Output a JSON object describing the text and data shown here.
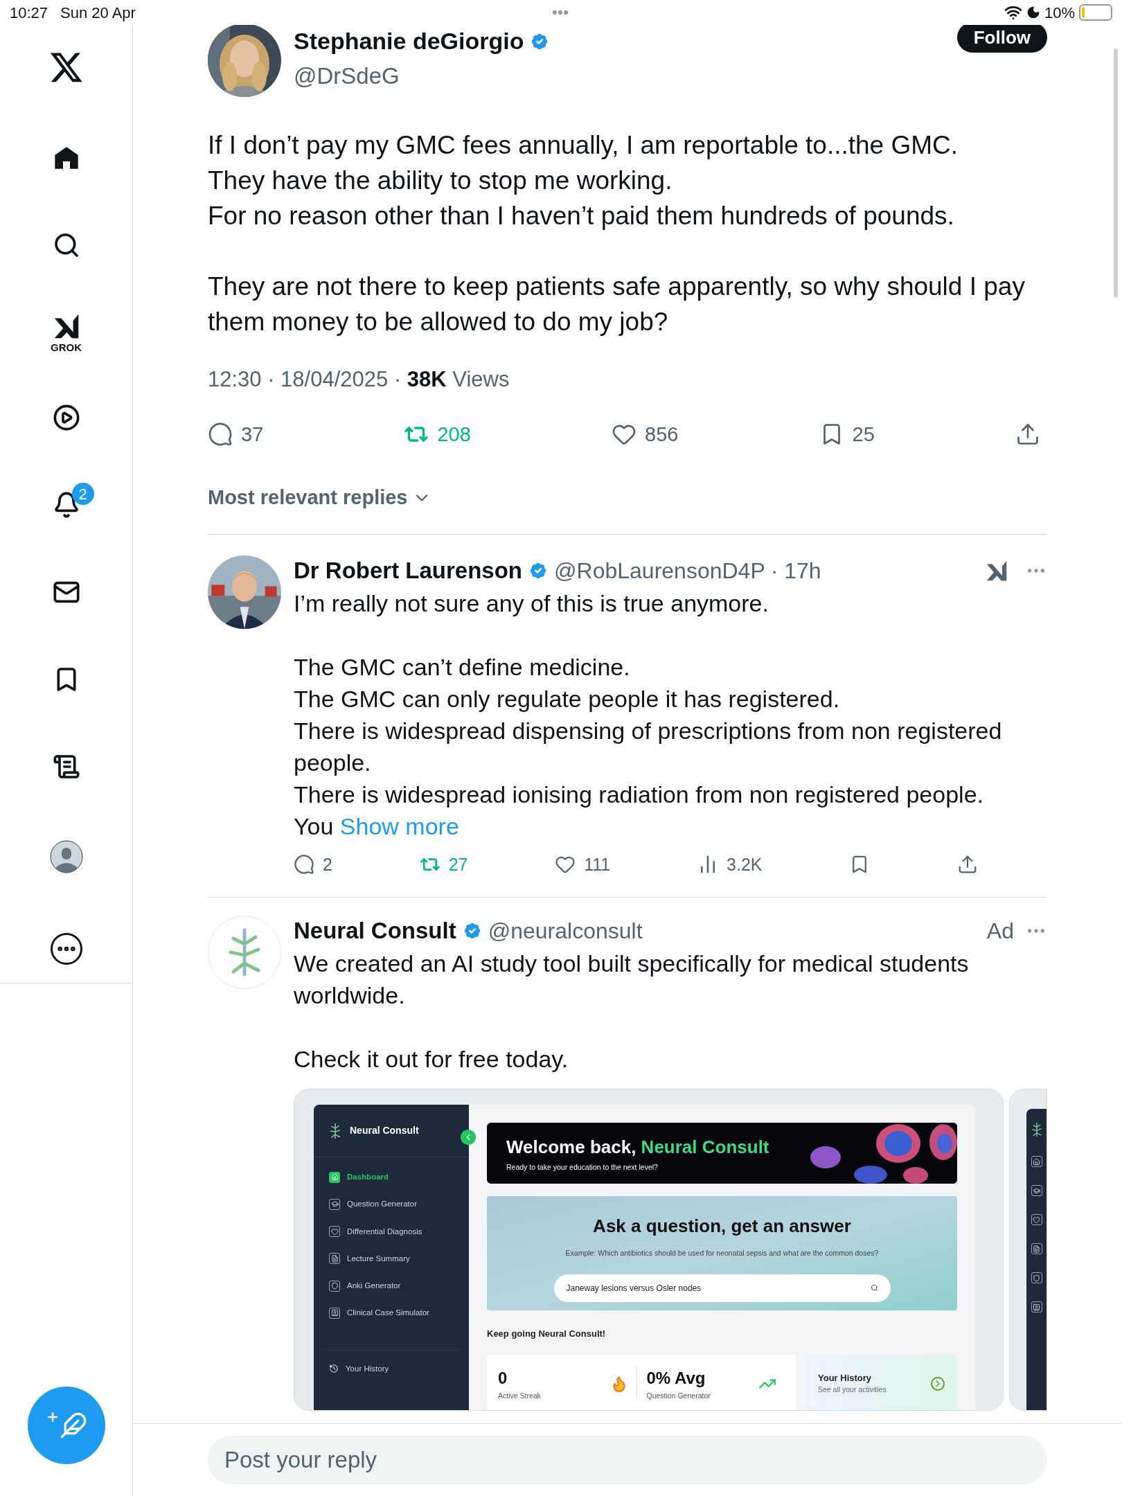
{
  "status_bar": {
    "time": "10:27",
    "date": "Sun 20 Apr",
    "battery": "10%"
  },
  "sidebar": {
    "grok_label": "GROK",
    "notifications_badge": "2"
  },
  "post": {
    "author": "Stephanie deGiorgio",
    "handle": "@DrSdeG",
    "follow": "Follow",
    "paragraphs": [
      [
        "If I don’t pay my GMC fees annually, I am reportable to...the GMC.",
        "They have the ability to stop me working.",
        "For no reason other than I haven’t paid them hundreds of pounds."
      ],
      [
        "They are not there to keep patients safe apparently, so why should I pay them money to be allowed to do my job?"
      ]
    ],
    "timestamp": "12:30 · 18/04/2025 · ",
    "views_count": "38K",
    "views_label": "Views",
    "stats": [
      {
        "kind": "reply",
        "count": "37",
        "active": false
      },
      {
        "kind": "repost",
        "count": "208",
        "active": true
      },
      {
        "kind": "like",
        "count": "856",
        "active": false
      },
      {
        "kind": "bookmark",
        "count": "25",
        "active": false
      },
      {
        "kind": "share",
        "active": false
      }
    ]
  },
  "replies_sort": "Most relevant replies",
  "reply": {
    "author": "Dr Robert Laurenson",
    "handle": "@RobLaurensonD4P",
    "age": "· 17h",
    "paragraphs": [
      [
        "I’m really not sure any of this is true anymore."
      ],
      [
        "The GMC can’t define medicine.",
        "The GMC can only regulate people it has registered.",
        "There is widespread dispensing of prescriptions from non registered people.",
        "There is widespread ionising radiation from non registered people.",
        "You"
      ]
    ],
    "show_more": "Show more",
    "stats": [
      {
        "kind": "reply",
        "count": "2",
        "active": false
      },
      {
        "kind": "repost",
        "count": "27",
        "active": true
      },
      {
        "kind": "like",
        "count": "111",
        "active": false
      },
      {
        "kind": "views",
        "count": "3.2K",
        "active": false
      },
      {
        "kind": "bookmark",
        "active": false
      },
      {
        "kind": "share",
        "active": false
      }
    ]
  },
  "ad": {
    "author": "Neural Consult",
    "handle": "@neuralconsult",
    "label": "Ad",
    "paragraphs": [
      [
        "We created an AI study tool built specifically for medical students worldwide."
      ],
      [
        "Check it out for free today."
      ]
    ],
    "media": {
      "brand": "Neural Consult",
      "nav": [
        {
          "label": "Dashboard",
          "selected": true
        },
        {
          "label": "Question Generator",
          "selected": false
        },
        {
          "label": "Differential Diagnosis",
          "selected": false
        },
        {
          "label": "Lecture Summary",
          "selected": false
        },
        {
          "label": "Anki Generator",
          "selected": false
        },
        {
          "label": "Clinical Case Simulator",
          "selected": false
        }
      ],
      "history_nav": "Your History",
      "welcome_prefix": "Welcome back, ",
      "welcome_name": "Neural Consult",
      "welcome_sub": "Ready to take your education to the next level?",
      "ask_title": "Ask a question, get an answer",
      "ask_example": "Example: Which antibiotics should be used for neonatal sepsis and what are the common doses?",
      "search_value": "Janeway lesions versus Osler nodes",
      "keep_going": "Keep going Neural Consult!",
      "stats": [
        {
          "value": "0",
          "label": "Active Streak"
        },
        {
          "value": "0% Avg",
          "label": "Question Generator"
        }
      ],
      "history_title": "Your History",
      "history_subtitle": "See all your activities"
    }
  },
  "reply_field": {
    "placeholder": "Post your reply"
  }
}
